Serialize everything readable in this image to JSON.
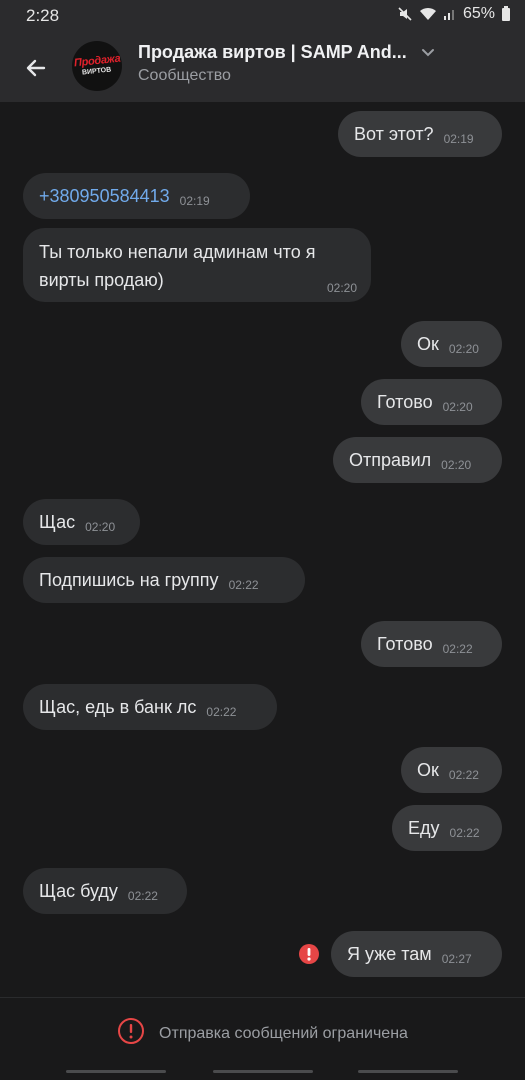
{
  "status_bar": {
    "time": "2:28",
    "battery": "65%"
  },
  "header": {
    "title": "Продажа виртов | SAMP And...",
    "subtitle": "Сообщество",
    "avatar_top": "Продажа",
    "avatar_bottom": "ВИРТОВ"
  },
  "messages": [
    {
      "dir": "out",
      "text": "Вот этот?",
      "time": "02:19"
    },
    {
      "dir": "in",
      "text": "+380950584413",
      "time": "02:19",
      "link": true
    },
    {
      "dir": "in",
      "text": "Ты только непали админам что я",
      "text2": "вирты продаю)",
      "time": "02:20"
    },
    {
      "dir": "out",
      "text": "Ок",
      "time": "02:20"
    },
    {
      "dir": "out",
      "text": "Готово",
      "time": "02:20"
    },
    {
      "dir": "out",
      "text": "Отправил",
      "time": "02:20"
    },
    {
      "dir": "in",
      "text": "Щас",
      "time": "02:20"
    },
    {
      "dir": "in",
      "text": "Подпишись на группу",
      "time": "02:22"
    },
    {
      "dir": "out",
      "text": "Готово",
      "time": "02:22"
    },
    {
      "dir": "in",
      "text": "Щас, едь в банк лс",
      "time": "02:22"
    },
    {
      "dir": "out",
      "text": "Ок",
      "time": "02:22"
    },
    {
      "dir": "out",
      "text": "Еду",
      "time": "02:22"
    },
    {
      "dir": "in",
      "text": "Щас буду",
      "time": "02:22"
    },
    {
      "dir": "out",
      "text": "Я уже там",
      "time": "02:27",
      "failed": true
    }
  ],
  "footer": {
    "restricted_text": "Отправка сообщений ограничена"
  },
  "colors": {
    "background": "#19191a",
    "bar": "#2b2b2d",
    "bubble_in": "#2c2d2f",
    "bubble_out": "#393a3c",
    "link": "#71aaeb",
    "error": "#e64646"
  }
}
